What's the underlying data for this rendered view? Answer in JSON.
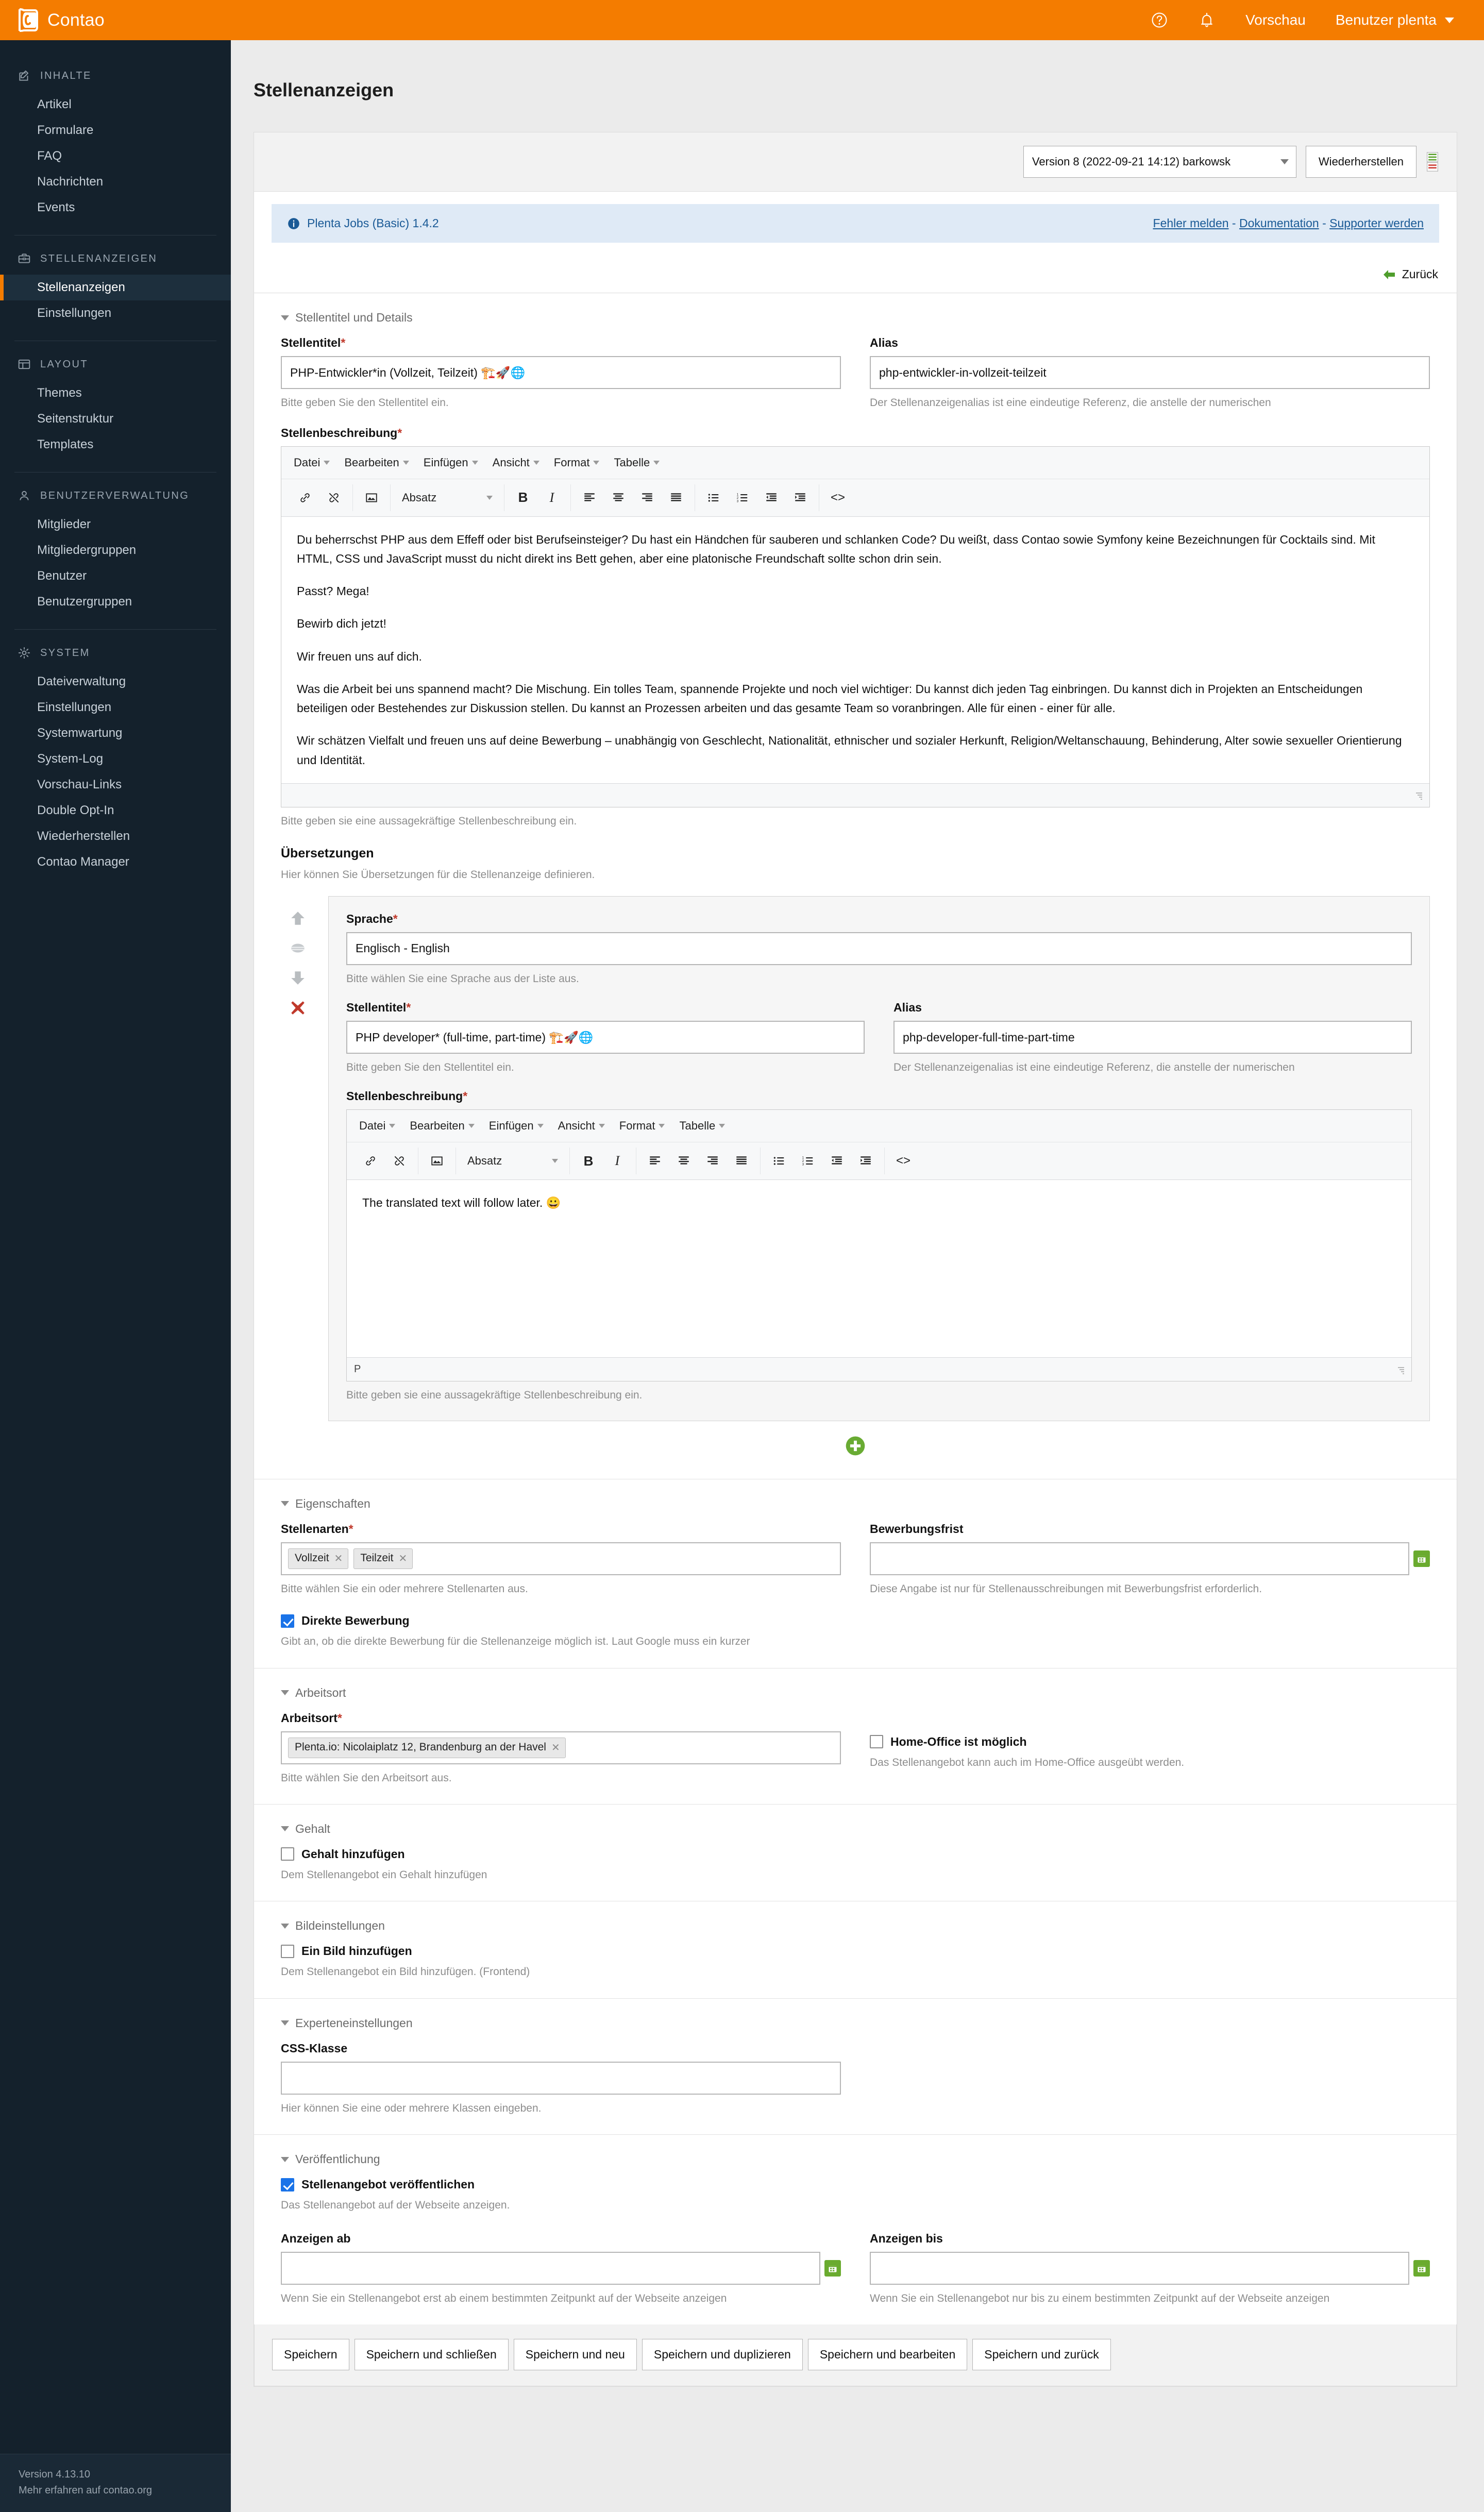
{
  "topbar": {
    "brand": "Contao",
    "help_icon": "question-circle-icon",
    "alerts_icon": "bell-icon",
    "preview": "Vorschau",
    "user": "Benutzer plenta"
  },
  "sidebar": {
    "groups": [
      {
        "icon": "pencil-square-icon",
        "title": "INHALTE",
        "items": [
          {
            "label": "Artikel",
            "active": false
          },
          {
            "label": "Formulare",
            "active": false
          },
          {
            "label": "FAQ",
            "active": false
          },
          {
            "label": "Nachrichten",
            "active": false
          },
          {
            "label": "Events",
            "active": false
          }
        ]
      },
      {
        "icon": "briefcase-icon",
        "title": "STELLENANZEIGEN",
        "items": [
          {
            "label": "Stellenanzeigen",
            "active": true
          },
          {
            "label": "Einstellungen",
            "active": false
          }
        ]
      },
      {
        "icon": "layout-icon",
        "title": "LAYOUT",
        "items": [
          {
            "label": "Themes",
            "active": false
          },
          {
            "label": "Seitenstruktur",
            "active": false
          },
          {
            "label": "Templates",
            "active": false
          }
        ]
      },
      {
        "icon": "user-icon",
        "title": "BENUTZERVERWALTUNG",
        "items": [
          {
            "label": "Mitglieder",
            "active": false
          },
          {
            "label": "Mitgliedergruppen",
            "active": false
          },
          {
            "label": "Benutzer",
            "active": false
          },
          {
            "label": "Benutzergruppen",
            "active": false
          }
        ]
      },
      {
        "icon": "gear-icon",
        "title": "SYSTEM",
        "items": [
          {
            "label": "Dateiverwaltung",
            "active": false
          },
          {
            "label": "Einstellungen",
            "active": false
          },
          {
            "label": "Systemwartung",
            "active": false
          },
          {
            "label": "System-Log",
            "active": false
          },
          {
            "label": "Vorschau-Links",
            "active": false
          },
          {
            "label": "Double Opt-In",
            "active": false
          },
          {
            "label": "Wiederherstellen",
            "active": false
          },
          {
            "label": "Contao Manager",
            "active": false
          }
        ]
      }
    ],
    "footer_version": "Version 4.13.10",
    "footer_link": "Mehr erfahren auf contao.org"
  },
  "page": {
    "title": "Stellenanzeigen"
  },
  "versionbar": {
    "selected_version": "Version 8 (2022-09-21 14:12) barkowsk",
    "restore_button": "Wiederherstellen",
    "diff_icon": "version-diff-icon"
  },
  "infobar": {
    "icon": "info-icon",
    "text": "Plenta Jobs (Basic) 1.4.2",
    "links": [
      "Fehler melden",
      "Dokumentation",
      "Supporter werden"
    ],
    "separator": " - "
  },
  "back": {
    "label": "Zurück",
    "icon": "arrow-left-icon"
  },
  "sections": {
    "details": {
      "legend": "Stellentitel und Details",
      "title_label": "Stellentitel",
      "title_value": "PHP-Entwickler*in (Vollzeit, Teilzeit) 🏗️🚀🌐",
      "title_hint": "Bitte geben Sie den Stellentitel ein.",
      "alias_label": "Alias",
      "alias_value": "php-entwickler-in-vollzeit-teilzeit",
      "alias_hint": "Der Stellenanzeigenalias ist eine eindeutige Referenz, die anstelle der numerischen",
      "description_label": "Stellenbeschreibung",
      "description_hint": "Bitte geben sie eine aussagekräftige Stellenbeschreibung ein.",
      "description_paragraphs": [
        "Du beherrschst PHP aus dem Effeff oder bist Berufseinsteiger? Du hast ein Händchen für sauberen und schlanken Code? Du weißt, dass Contao sowie Symfony keine Bezeichnungen für Cocktails sind. Mit HTML, CSS und JavaScript musst du nicht direkt ins Bett gehen, aber eine platonische Freundschaft sollte schon drin sein.",
        "Passt? Mega!",
        "Bewirb dich jetzt!",
        "Wir freuen uns auf dich.",
        "Was die Arbeit bei uns spannend macht? Die Mischung. Ein tolles Team, spannende Projekte und noch viel wichtiger: Du kannst dich jeden Tag einbringen. Du kannst dich in Projekten an Entscheidungen beteiligen oder Bestehendes zur Diskussion stellen. Du kannst an Prozessen arbeiten und das gesamte Team so voranbringen. Alle für einen - einer für alle.",
        "Wir schätzen Vielfalt und freuen uns auf deine Bewerbung – unabhängig von Geschlecht, Nationalität, ethnischer und sozialer Herkunft, Religion/Weltanschauung, Behinderung, Alter sowie sexueller Orientierung und Identität."
      ]
    },
    "translations": {
      "heading": "Übersetzungen",
      "hint": "Hier können Sie Übersetzungen für die Stellenanzeige definieren.",
      "language_label": "Sprache",
      "language_value": "Englisch - English",
      "language_hint": "Bitte wählen Sie eine Sprache aus der Liste aus.",
      "title_label": "Stellentitel",
      "title_value": "PHP developer* (full-time, part-time) 🏗️🚀🌐",
      "title_hint": "Bitte geben Sie den Stellentitel ein.",
      "alias_label": "Alias",
      "alias_value": "php-developer-full-time-part-time",
      "alias_hint": "Der Stellenanzeigenalias ist eine eindeutige Referenz, die anstelle der numerischen",
      "description_label": "Stellenbeschreibung",
      "description_hint": "Bitte geben sie eine aussagekräftige Stellenbeschreibung ein.",
      "description_text": "The translated text will follow later. 😀",
      "status_path": "P",
      "move_up_icon": "arrow-up-icon",
      "drag_icon": "drag-handle-icon",
      "move_down_icon": "arrow-down-icon",
      "delete_icon": "delete-x-icon",
      "add_icon": "add-circle-icon"
    },
    "properties": {
      "legend": "Eigenschaften",
      "jobtypes_label": "Stellenarten",
      "jobtypes_tags": [
        "Vollzeit",
        "Teilzeit"
      ],
      "jobtypes_hint": "Bitte wählen Sie ein oder mehrere Stellenarten aus.",
      "deadline_label": "Bewerbungsfrist",
      "deadline_value": "",
      "deadline_hint": "Diese Angabe ist nur für Stellenausschreibungen mit Bewerbungsfrist erforderlich.",
      "direct_application_label": "Direkte Bewerbung",
      "direct_application_checked": true,
      "direct_application_hint": "Gibt an, ob die direkte Bewerbung für die Stellenanzeige möglich ist. Laut Google muss ein kurzer"
    },
    "workplace": {
      "legend": "Arbeitsort",
      "location_label": "Arbeitsort",
      "location_tags": [
        "Plenta.io: Nicolaiplatz 12, Brandenburg an der Havel"
      ],
      "location_hint": "Bitte wählen Sie den Arbeitsort aus.",
      "homeoffice_label": "Home-Office ist möglich",
      "homeoffice_checked": false,
      "homeoffice_hint": "Das Stellenangebot kann auch im Home-Office ausgeübt werden."
    },
    "salary": {
      "legend": "Gehalt",
      "add_salary_label": "Gehalt hinzufügen",
      "add_salary_checked": false,
      "add_salary_hint": "Dem Stellenangebot ein Gehalt hinzufügen"
    },
    "image": {
      "legend": "Bildeinstellungen",
      "add_image_label": "Ein Bild hinzufügen",
      "add_image_checked": false,
      "add_image_hint": "Dem Stellenangebot ein Bild hinzufügen. (Frontend)"
    },
    "expert": {
      "legend": "Experteneinstellungen",
      "cssclass_label": "CSS-Klasse",
      "cssclass_value": "",
      "cssclass_hint": "Hier können Sie eine oder mehrere Klassen eingeben."
    },
    "publish": {
      "legend": "Veröffentlichung",
      "publish_label": "Stellenangebot veröffentlichen",
      "publish_checked": true,
      "publish_hint": "Das Stellenangebot auf der Webseite anzeigen.",
      "start_label": "Anzeigen ab",
      "start_value": "",
      "start_hint": "Wenn Sie ein Stellenangebot erst ab einem bestimmten Zeitpunkt auf der Webseite anzeigen",
      "stop_label": "Anzeigen bis",
      "stop_value": "",
      "stop_hint": "Wenn Sie ein Stellenangebot nur bis zu einem bestimmten Zeitpunkt auf der Webseite anzeigen"
    }
  },
  "editor": {
    "menus": [
      "Datei",
      "Bearbeiten",
      "Einfügen",
      "Ansicht",
      "Format",
      "Tabelle"
    ],
    "format_value": "Absatz",
    "tools": {
      "link": "link-icon",
      "unlink": "unlink-icon",
      "image": "image-icon",
      "bold": "bold-icon",
      "italic": "italic-icon",
      "align_left": "align-left-icon",
      "align_center": "align-center-icon",
      "align_right": "align-right-icon",
      "align_justify": "align-justify-icon",
      "bullet_list": "bullet-list-icon",
      "numbered_list": "numbered-list-icon",
      "outdent": "outdent-icon",
      "indent": "indent-icon",
      "source_code": "source-code-icon"
    }
  },
  "submit": {
    "buttons": [
      "Speichern",
      "Speichern und schließen",
      "Speichern und neu",
      "Speichern und duplizieren",
      "Speichern und bearbeiten",
      "Speichern und zurück"
    ]
  },
  "colors": {
    "brand_orange": "#f47c00",
    "sidebar_dark": "#14212c",
    "info_blue_bg": "#dfeaf6",
    "info_blue_text": "#1a5a96",
    "checkbox_blue": "#1a73e8",
    "green_accent": "#6aab2f",
    "delete_red": "#c0392b"
  }
}
